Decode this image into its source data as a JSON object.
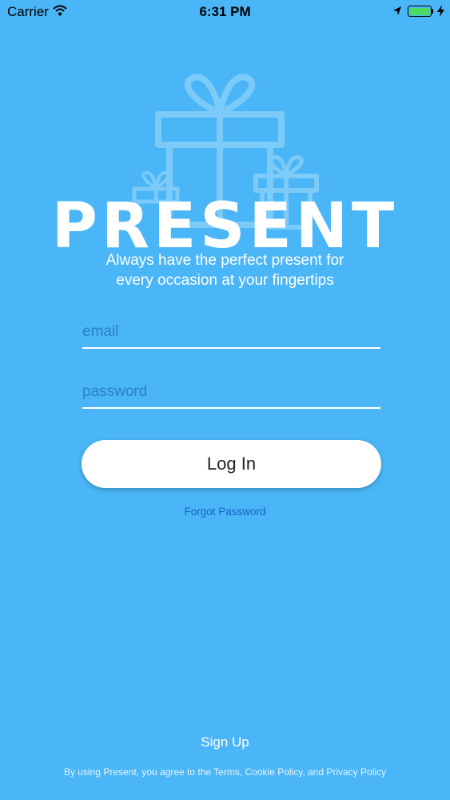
{
  "status_bar": {
    "carrier": "Carrier",
    "time": "6:31 PM",
    "battery_level": 1.0
  },
  "app": {
    "logo": "PRESENT",
    "tagline_line1": "Always have the perfect present for",
    "tagline_line2": "every occasion at your fingertips"
  },
  "form": {
    "email_placeholder": "email",
    "password_placeholder": "password",
    "login_label": "Log In",
    "forgot_label": "Forgot Password"
  },
  "footer": {
    "signup_label": "Sign Up",
    "terms_text": "By using Present, you agree to the Terms, Cookie Policy, and Privacy Policy"
  },
  "colors": {
    "background": "#4ab6f7",
    "link": "#1565c0",
    "battery": "#4cd964"
  },
  "icons": [
    "wifi-icon",
    "location-arrow-icon",
    "battery-icon",
    "charging-bolt-icon",
    "gift-boxes-icon"
  ]
}
